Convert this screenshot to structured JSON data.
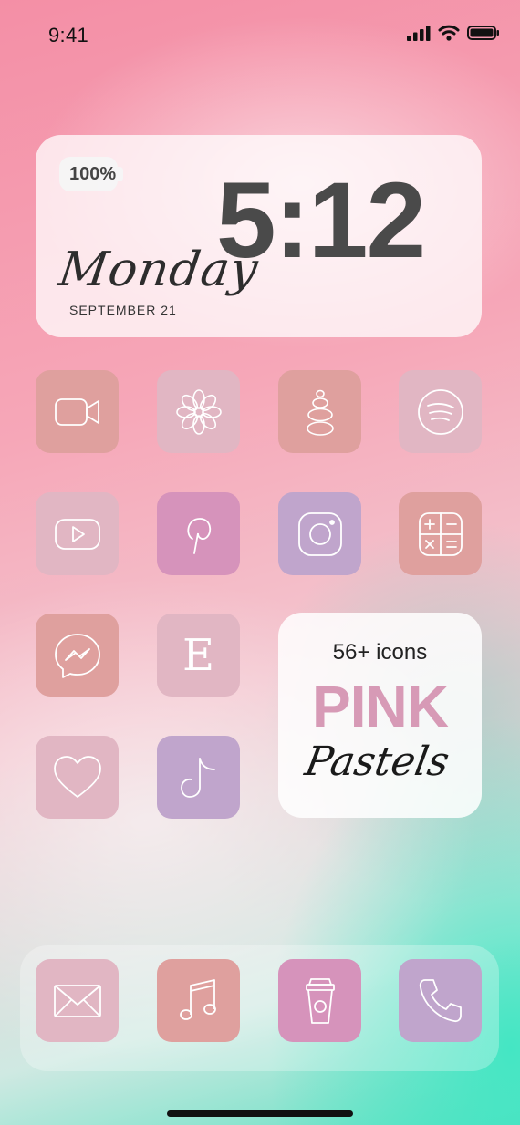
{
  "status_bar": {
    "time": "9:41",
    "icons": [
      "signal-icon",
      "wifi-icon",
      "battery-icon"
    ]
  },
  "widget": {
    "battery_percent": "100%",
    "clock": "5:12",
    "day": "Monday",
    "date": "SEPTEMBER 21"
  },
  "apps": [
    {
      "icon": "video-camera-icon",
      "color": "#dfa09e"
    },
    {
      "icon": "flower-icon",
      "color": "#e1b6c3"
    },
    {
      "icon": "stacked-stones-icon",
      "color": "#dfa09e"
    },
    {
      "icon": "spotify-icon",
      "color": "#e1b6c3"
    },
    {
      "icon": "youtube-icon",
      "color": "#e1b6c3"
    },
    {
      "icon": "pinterest-icon",
      "color": "#d693bb"
    },
    {
      "icon": "instagram-icon",
      "color": "#c0a5cc"
    },
    {
      "icon": "calculator-icon",
      "color": "#dfa09e"
    },
    {
      "icon": "messenger-icon",
      "color": "#dfa09e"
    },
    {
      "icon": "etsy-icon",
      "label": "E",
      "color": "#e1b6c3"
    },
    {
      "icon": "heart-icon",
      "color": "#e1b6c3"
    },
    {
      "icon": "tiktok-icon",
      "color": "#c0a5cc"
    }
  ],
  "promo": {
    "count": "56+ icons",
    "title": "PINK",
    "subtitle": "Pastels"
  },
  "dock": [
    {
      "icon": "mail-icon",
      "color": "#e1b6c3"
    },
    {
      "icon": "music-note-icon",
      "color": "#dfa09e"
    },
    {
      "icon": "coffee-cup-icon",
      "color": "#d693bb"
    },
    {
      "icon": "phone-icon",
      "color": "#c0a5cc"
    }
  ]
}
